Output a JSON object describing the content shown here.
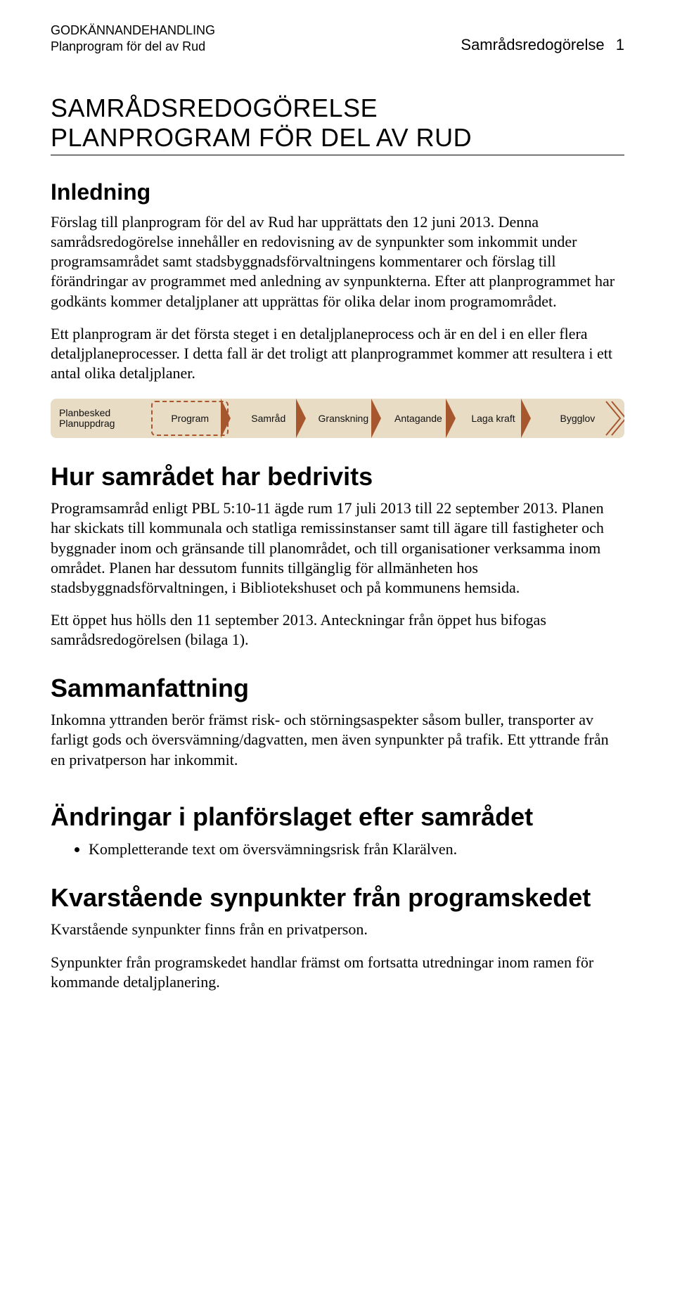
{
  "header": {
    "line1": "GODKÄNNANDEHANDLING",
    "line2": "Planprogram för del av Rud",
    "right_label": "Samrådsredogörelse",
    "page_number": "1"
  },
  "title": {
    "line1": "SAMRÅDSREDOGÖRELSE",
    "line2": "PLANPROGRAM FÖR DEL AV RUD"
  },
  "sections": {
    "inledning": {
      "heading": "Inledning",
      "p1": "Förslag till planprogram för del av Rud har upprättats den 12 juni 2013. Denna samrådsredogörelse innehåller en redovisning av de synpunkter som inkommit under programsamrådet samt stadsbyggnadsförvaltningens kommentarer och förslag till förändringar av programmet med anledning av synpunkterna. Efter att planprogrammet har godkänts kommer detaljplaner att upprättas för olika delar inom programområdet.",
      "p2": "Ett planprogram är det första steget i en detaljplaneprocess och är en del i en eller flera detaljplaneprocesser. I detta fall är det troligt att planprogrammet kommer att resultera i ett antal olika detaljplaner."
    },
    "process": {
      "steps": [
        "Planbesked\nPlanuppdrag",
        "Program",
        "Samråd",
        "Granskning",
        "Antagande",
        "Laga kraft",
        "Bygglov"
      ]
    },
    "hur": {
      "heading": "Hur samrådet har bedrivits",
      "p1": "Programsamråd enligt PBL 5:10-11 ägde rum 17 juli 2013 till 22 september 2013. Planen har skickats till kommunala och statliga remissinstanser samt till ägare till fastigheter och byggnader inom och gränsande till planområdet, och till organisationer verksamma inom området. Planen har dessutom funnits tillgänglig för allmänheten hos stadsbyggnadsförvaltningen, i Bibliotekshuset och på kommunens hemsida.",
      "p2": "Ett öppet hus hölls den 11 september 2013. Anteckningar från öppet hus bifogas samrådsredogörelsen (bilaga 1)."
    },
    "sammanfattning": {
      "heading": "Sammanfattning",
      "p1": "Inkomna yttranden berör främst risk- och störningsaspekter såsom buller, transporter av farligt gods och översvämning/dagvatten, men även synpunkter på trafik. Ett yttrande från en privatperson har inkommit."
    },
    "andringar": {
      "heading": "Ändringar i planförslaget efter samrådet",
      "bullet1": "Kompletterande text om översvämningsrisk från Klarälven."
    },
    "kvarstaende": {
      "heading": "Kvarstående synpunkter från programskedet",
      "p1": "Kvarstående synpunkter finns från en privatperson.",
      "p2": "Synpunkter från programskedet handlar främst om fortsatta utredningar inom ramen för kommande detaljplanering."
    }
  }
}
